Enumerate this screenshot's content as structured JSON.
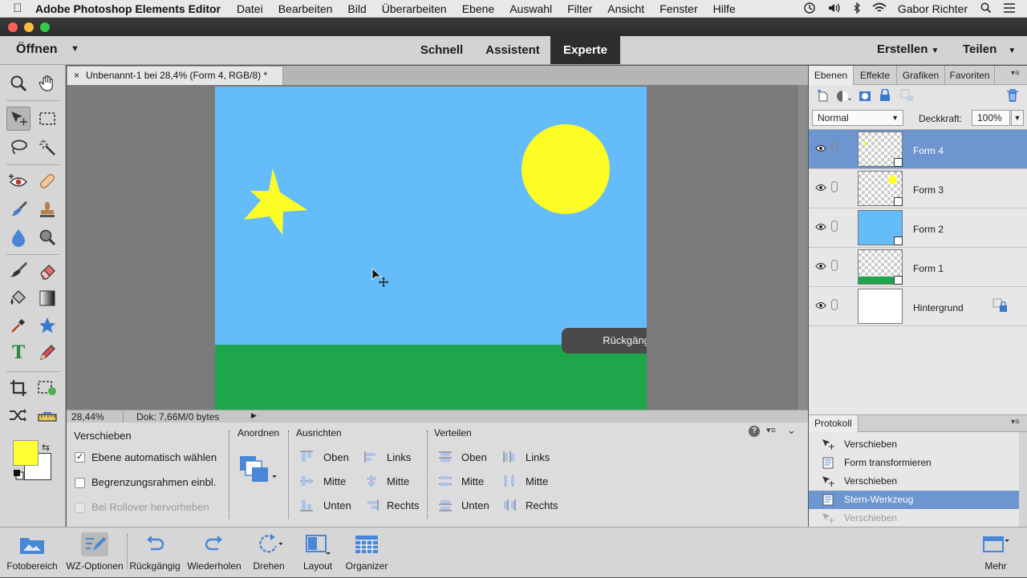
{
  "menubar": {
    "app_name": "Adobe Photoshop Elements Editor",
    "items": [
      "Datei",
      "Bearbeiten",
      "Bild",
      "Überarbeiten",
      "Ebene",
      "Auswahl",
      "Filter",
      "Ansicht",
      "Fenster",
      "Hilfe"
    ],
    "user": "Gabor Richter"
  },
  "modebar": {
    "open_label": "Öffnen",
    "tabs": [
      "Schnell",
      "Assistent",
      "Experte"
    ],
    "active_tab": "Experte",
    "create_label": "Erstellen",
    "share_label": "Teilen"
  },
  "document": {
    "tab_title": "Unbenannt-1 bei 28,4% (Form 4, RGB/8) *",
    "close_glyph": "×",
    "toast": "Rückgängig: Verschieben",
    "zoom": "28,44%",
    "doc_info": "Dok: 7,66M/0 bytes",
    "colors": {
      "sky": "#65bcfb",
      "grass": "#1ea64c",
      "sun": "#fdfd26",
      "star": "#fdfd26"
    }
  },
  "options": {
    "tool_name": "Verschieben",
    "auto_select": "Ebene automatisch wählen",
    "bounding_box": "Begrenzungsrahmen einbl.",
    "rollover": "Bei Rollover hervorheben",
    "arrange_title": "Anordnen",
    "align_title": "Ausrichten",
    "distribute_title": "Verteilen",
    "align_col1": [
      "Oben",
      "Mitte",
      "Unten"
    ],
    "align_col2": [
      "Links",
      "Mitte",
      "Rechts"
    ],
    "distribute_col1": [
      "Oben",
      "Mitte",
      "Unten"
    ],
    "distribute_col2": [
      "Links",
      "Mitte",
      "Rechts"
    ]
  },
  "panel": {
    "tabs": [
      "Ebenen",
      "Effekte",
      "Grafiken",
      "Favoriten"
    ],
    "active_tab": "Ebenen",
    "blend_mode": "Normal",
    "opacity_label": "Deckkraft:",
    "opacity_value": "100%",
    "layers": [
      {
        "name": "Form 4",
        "selected": true
      },
      {
        "name": "Form 3",
        "selected": false
      },
      {
        "name": "Form 2",
        "selected": false
      },
      {
        "name": "Form 1",
        "selected": false
      },
      {
        "name": "Hintergrund",
        "selected": false
      }
    ]
  },
  "history": {
    "title": "Protokoll",
    "items": [
      "Verschieben",
      "Form transformieren",
      "Verschieben",
      "Stern-Werkzeug",
      "Verschieben"
    ],
    "selected_index": 3
  },
  "taskbar": {
    "buttons": [
      "Fotobereich",
      "WZ-Optionen",
      "Rückgängig",
      "Wiederholen",
      "Drehen",
      "Layout",
      "Organizer"
    ],
    "more_label": "Mehr"
  },
  "foreground_color": "#ffff33",
  "background_color": "#ffffff"
}
